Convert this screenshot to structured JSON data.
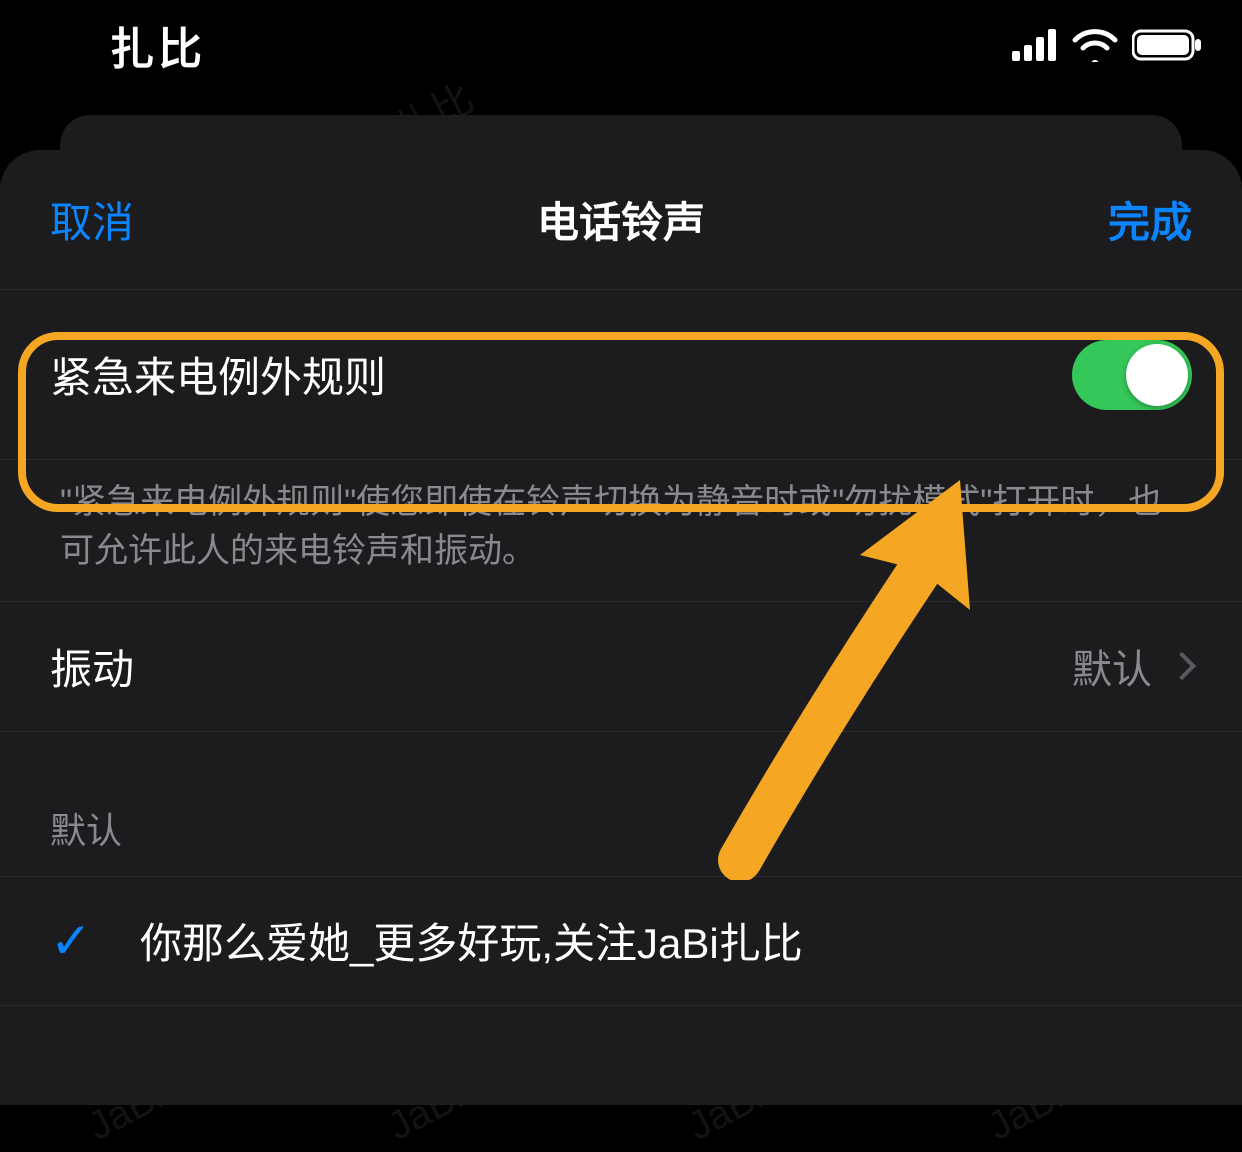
{
  "status": {
    "carrier": "扎比"
  },
  "nav": {
    "cancel": "取消",
    "title": "电话铃声",
    "done": "完成"
  },
  "emergency": {
    "label": "紧急来电例外规则",
    "enabled": true,
    "description": "\"紧急来电例外规则\"使您即使在铃声切换为静音时或\"勿扰模式\"打开时，也可允许此人的来电铃声和振动。"
  },
  "vibration": {
    "label": "振动",
    "value": "默认"
  },
  "default_section": {
    "header": "默认",
    "selected_item": "你那么爱她_更多好玩,关注JaBi扎比"
  },
  "watermark": "JaBi扎比",
  "colors": {
    "accent": "#0a84ff",
    "toggle_on": "#34c759",
    "highlight": "#f5a623"
  }
}
